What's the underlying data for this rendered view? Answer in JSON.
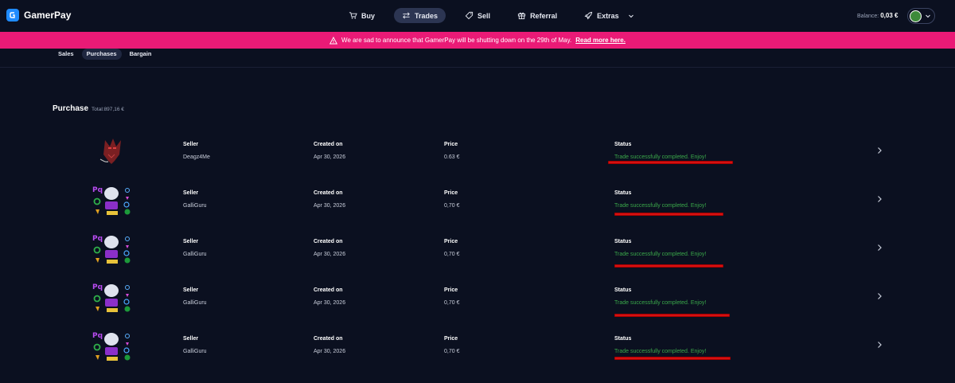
{
  "app": {
    "name": "GamerPay",
    "nav": [
      {
        "label": "Buy",
        "icon": "cart-icon"
      },
      {
        "label": "Trades",
        "icon": "swap-icon"
      },
      {
        "label": "Sell",
        "icon": "tag-icon"
      },
      {
        "label": "Referral",
        "icon": "gift-icon"
      },
      {
        "label": "Extras",
        "icon": "rocket-icon"
      }
    ],
    "balance_label": "Balance:",
    "balance_value": "0,03 €"
  },
  "banner": {
    "text": "We are sad to announce that GamerPay will be shutting down on the 29th of May.",
    "link": "Read more here."
  },
  "subtabs": [
    "Sales",
    "Purchases",
    "Bargain"
  ],
  "purchase": {
    "title": "Purchase",
    "total": "Total:897,16 €"
  },
  "columns": {
    "seller": "Seller",
    "created": "Created on",
    "price": "Price",
    "status": "Status"
  },
  "rows": [
    {
      "seller": "Deagz4Me",
      "created": "Apr 30, 2026",
      "price": "0.63 €",
      "status": "Trade successfully completed. Enjoy!"
    },
    {
      "seller": "GalliGuru",
      "created": "Apr 30, 2026",
      "price": "0,70 €",
      "status": "Trade successfully completed. Enjoy!"
    },
    {
      "seller": "GalliGuru",
      "created": "Apr 30, 2026",
      "price": "0,70 €",
      "status": "Trade successfully completed. Enjoy!"
    },
    {
      "seller": "GalliGuru",
      "created": "Apr 30, 2026",
      "price": "0,70 €",
      "status": "Trade successfully completed. Enjoy!"
    },
    {
      "seller": "GalliGuru",
      "created": "Apr 30, 2026",
      "price": "0,70 €",
      "status": "Trade successfully completed. Enjoy!"
    }
  ],
  "colors": {
    "banner": "#ea1a76",
    "status": "#3aa84a",
    "annotation": "#d41111"
  }
}
